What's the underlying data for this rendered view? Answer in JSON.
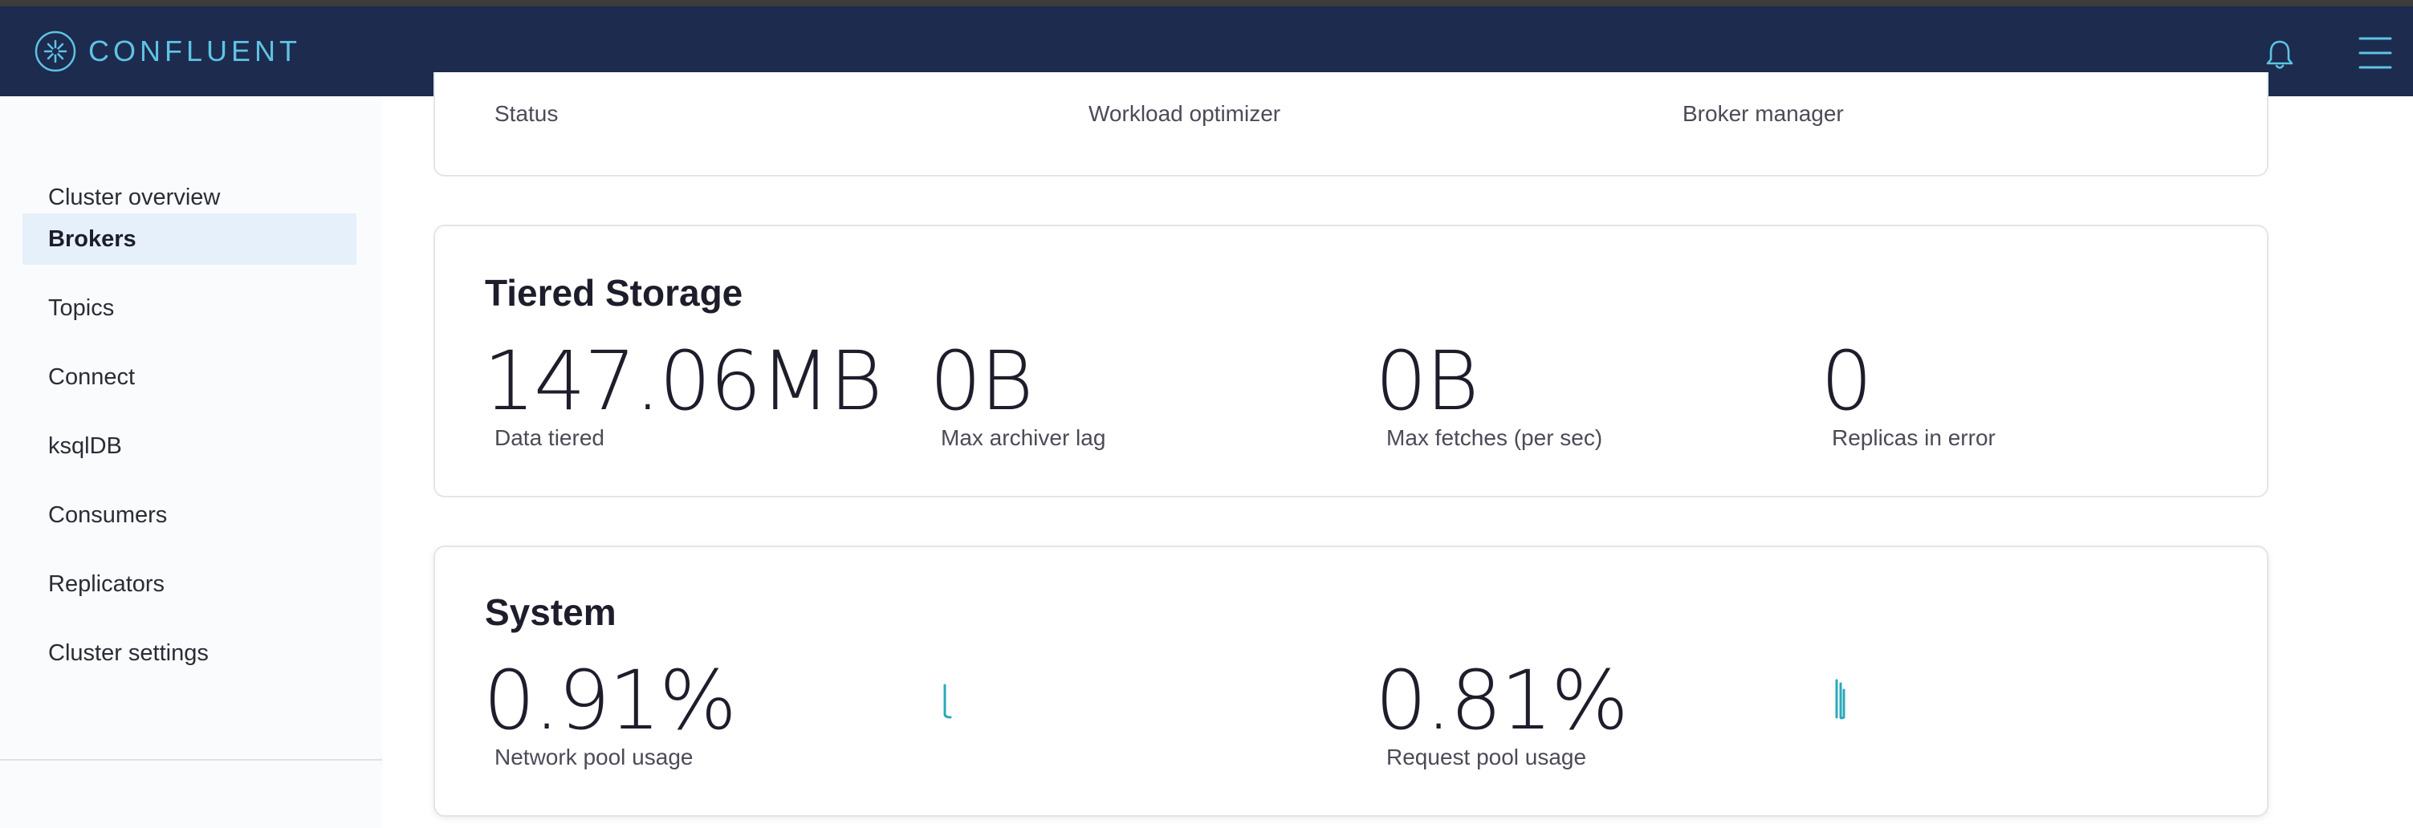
{
  "header": {
    "brand": "CONFLUENT",
    "logo_icon": "confluent-star-icon",
    "bell_icon": "bell-icon",
    "menu_icon": "hamburger-menu-icon",
    "brand_color": "#5fc3e4",
    "bar_color": "#1c2b4e"
  },
  "sidebar": {
    "items": [
      {
        "label": "Cluster overview",
        "active": false
      },
      {
        "label": "Brokers",
        "active": true
      },
      {
        "label": "Topics",
        "active": false
      },
      {
        "label": "Connect",
        "active": false
      },
      {
        "label": "ksqlDB",
        "active": false
      },
      {
        "label": "Consumers",
        "active": false
      },
      {
        "label": "Replicators",
        "active": false
      },
      {
        "label": "Cluster settings",
        "active": false
      }
    ]
  },
  "status_card": {
    "labels": [
      "Status",
      "Workload optimizer",
      "Broker manager"
    ]
  },
  "tiered_storage": {
    "title": "Tiered Storage",
    "metrics": [
      {
        "value": "147.06MB",
        "label": "Data tiered"
      },
      {
        "value": "0B",
        "label": "Max archiver lag"
      },
      {
        "value": "0B",
        "label": "Max fetches (per sec)"
      },
      {
        "value": "0",
        "label": "Replicas in error"
      }
    ]
  },
  "system": {
    "title": "System",
    "metrics": [
      {
        "value": "0.91%",
        "label": "Network pool usage"
      },
      {
        "value": "0.81%",
        "label": "Request pool usage"
      }
    ],
    "sparkline_color": "#2ba8b8"
  }
}
